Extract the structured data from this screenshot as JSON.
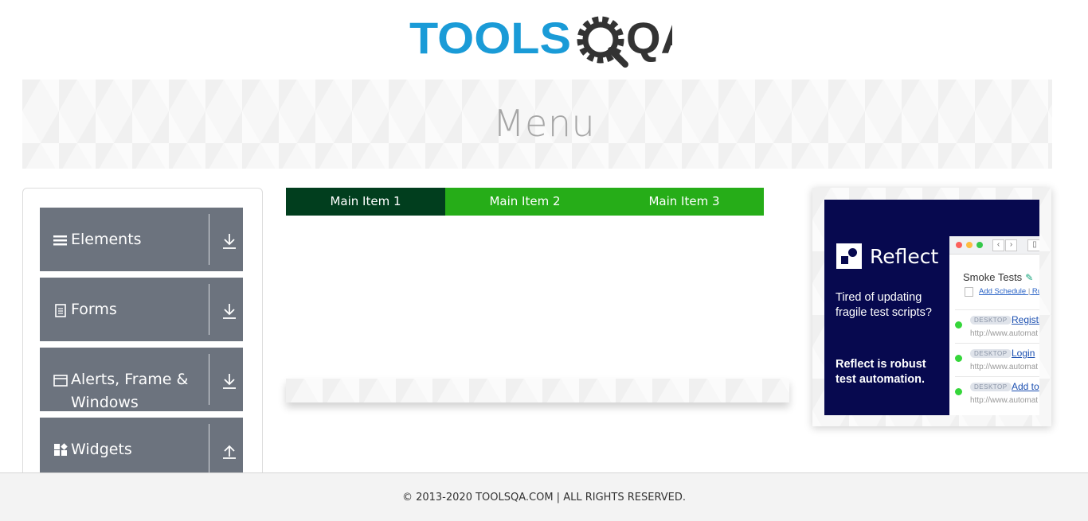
{
  "header": {
    "logo_text_primary": "TOOLS",
    "logo_text_secondary": "QA",
    "logo_color_primary": "#1a9bd7",
    "logo_color_secondary": "#333333"
  },
  "banner": {
    "title": "Menu"
  },
  "sidebar": {
    "groups": [
      {
        "label": "Elements",
        "icon": "hamburger-icon",
        "arrow": "download-arrow-icon"
      },
      {
        "label": "Forms",
        "icon": "document-icon",
        "arrow": "download-arrow-icon"
      },
      {
        "label": "Alerts, Frame & Windows",
        "icon": "window-icon",
        "arrow": "download-arrow-icon"
      },
      {
        "label": "Widgets",
        "icon": "widgets-icon",
        "arrow": "upload-arrow-icon"
      }
    ]
  },
  "menu": {
    "items": [
      {
        "label": "Main Item 1",
        "active": true
      },
      {
        "label": "Main Item 2",
        "active": false
      },
      {
        "label": "Main Item 3",
        "active": false
      }
    ],
    "colors": {
      "active": "#013e1e",
      "default": "#26ad18"
    }
  },
  "ad": {
    "brand": "Reflect",
    "tagline": "Tired of updating fragile test scripts?",
    "tagline2": "Reflect is robust test automation.",
    "window": {
      "title": "Smoke Tests",
      "schedule_link": "Add Schedule",
      "separator": "|",
      "run_link": "Ru",
      "rows": [
        {
          "badge": "DESKTOP",
          "name": "Registr",
          "url": "http://www.automat"
        },
        {
          "badge": "DESKTOP",
          "name": "Login",
          "url": "http://www.automat"
        },
        {
          "badge": "DESKTOP",
          "name": "Add to",
          "url": "http://www.automat"
        }
      ]
    }
  },
  "footer": {
    "text": "© 2013-2020 TOOLSQA.COM | ALL RIGHTS RESERVED."
  }
}
